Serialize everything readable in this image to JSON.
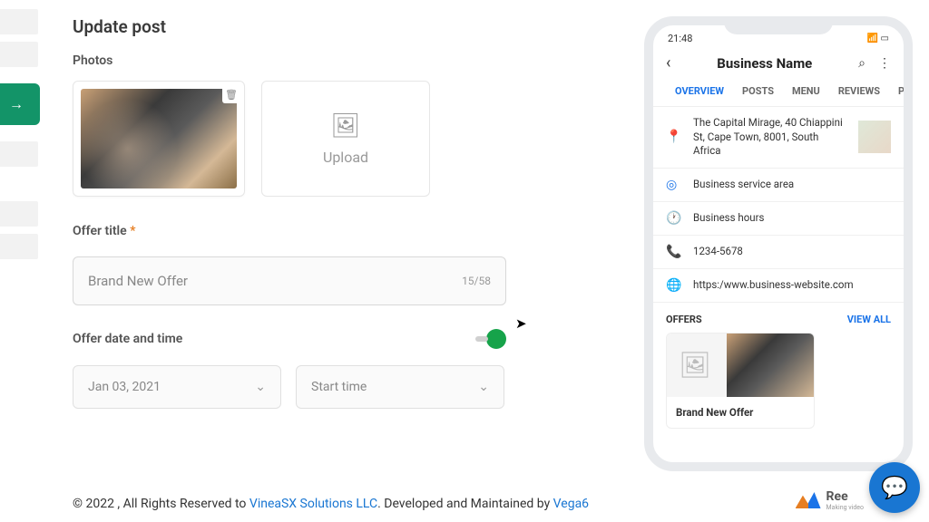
{
  "page": {
    "title": "Update post",
    "photos_label": "Photos",
    "upload_label": "Upload"
  },
  "form": {
    "offer_title_label": "Offer title",
    "offer_title_value": "Brand New Offer",
    "counter": "15/58",
    "datetime_label": "Offer date and time",
    "date": "Jan 03, 2021",
    "start_time": "Start time"
  },
  "preview": {
    "time": "21:48",
    "title": "Business Name",
    "tabs": [
      "OVERVIEW",
      "POSTS",
      "MENU",
      "REVIEWS",
      "PHOT"
    ],
    "address": "The Capital Mirage, 40 Chiappini St, Cape Town, 8001, South Africa",
    "service": "Business service area",
    "hours": "Business hours",
    "phone": "1234-5678",
    "url": "https:/www.business-website.com",
    "offers_label": "OFFERS",
    "view_all": "VIEW ALL",
    "offer_title": "Brand New Offer"
  },
  "footer": {
    "p1": "© 2022 , All Rights Reserved to ",
    "link1": "VineaSX Solutions LLC",
    "p2": ". Developed and Maintained by ",
    "link2": "Vega6",
    "brand": "Ree",
    "brand_sub": "Making video"
  }
}
